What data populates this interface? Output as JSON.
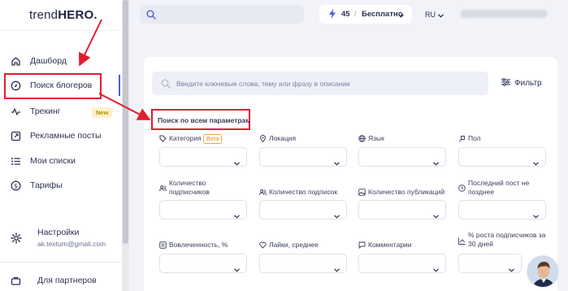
{
  "sidebar": {
    "logo": {
      "part1": "trend",
      "part2": "HERO",
      "dot": "."
    },
    "items": [
      {
        "label": "Дашборд",
        "icon": "home-icon"
      },
      {
        "label": "Поиск блогеров",
        "icon": "compass-icon"
      },
      {
        "label": "Трекинг",
        "icon": "pulse-icon",
        "badge": "New"
      },
      {
        "label": "Рекламные посты",
        "icon": "external-link-icon"
      },
      {
        "label": "Мои списки",
        "icon": "list-icon"
      },
      {
        "label": "Тарифы",
        "icon": "dollar-icon"
      }
    ],
    "settings": {
      "title": "Настройки",
      "email": "ak.textum@gmail.com",
      "icon": "gear-icon"
    },
    "partners": {
      "label": "Для партнеров",
      "icon": "briefcase-icon"
    }
  },
  "topbar": {
    "plan_count": "45",
    "plan_slash": "/",
    "plan_tier": "Бесплатно",
    "language": "RU"
  },
  "search": {
    "placeholder": "Введите ключевые слова, тему или фразу в описании",
    "filter_label": "Фильтр"
  },
  "section_title": "Поиск по всем параметрам",
  "filters": {
    "category": {
      "label": "Категория",
      "badge": "Beta"
    },
    "location": "Локация",
    "language": "Язык",
    "gender": "Пол",
    "followers_count_line1": "Количество",
    "followers_count_line2": "подписчиков",
    "following_count": "Количество подписок",
    "posts_count": "Количество публикаций",
    "last_post_line1": "Последний пост не",
    "last_post_line2": "позднее",
    "engagement": "Вовлеченность, %",
    "likes_avg": "Лайки, среднее",
    "comments": "Комментарии",
    "growth_line1": "% роста подписчиков за",
    "growth_line2": "30 дней"
  },
  "colors": {
    "accent": "#4f5bd5",
    "annotation": "#e11d31",
    "badge_new_bg": "#fff1c7",
    "beta_border": "#f0a23a"
  }
}
